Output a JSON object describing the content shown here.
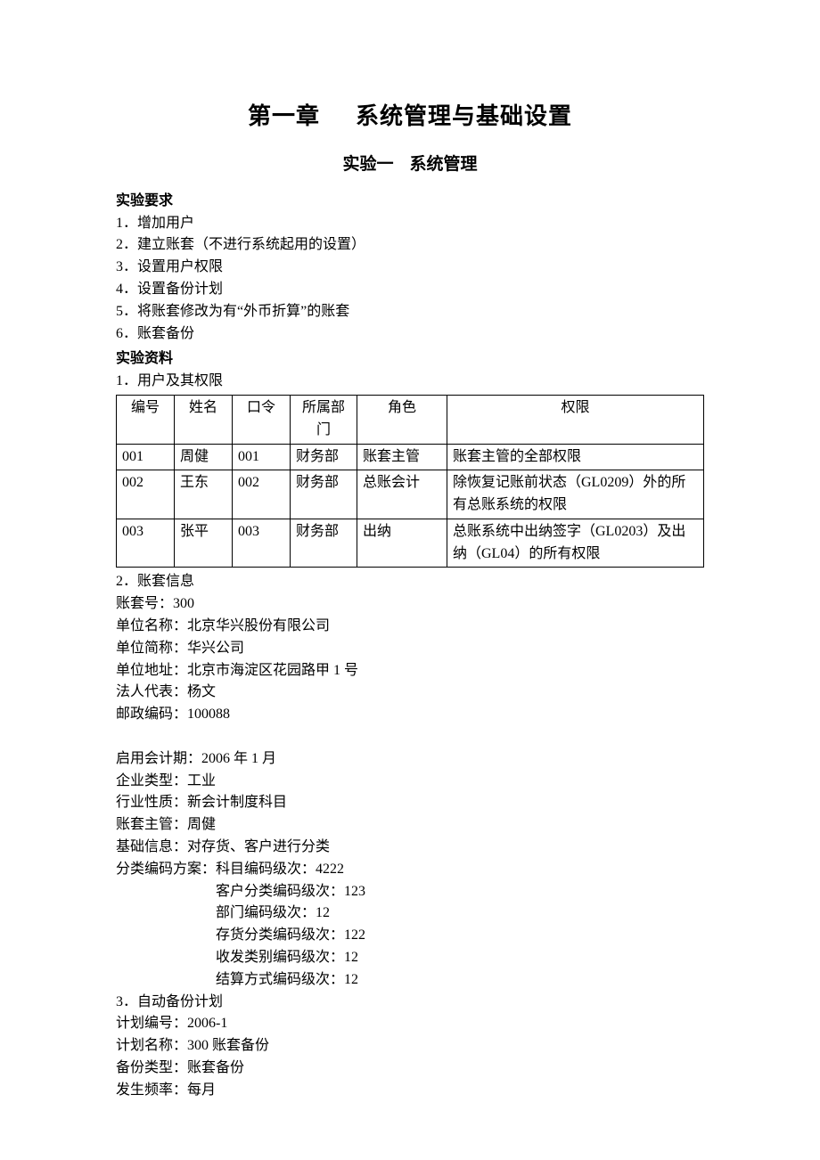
{
  "heading": {
    "chapter_left": "第一章",
    "chapter_right": "系统管理与基础设置",
    "subtitle_left": "实验一",
    "subtitle_right": "系统管理"
  },
  "requirements": {
    "heading": "实验要求",
    "items": [
      "1．增加用户",
      "2．建立账套（不进行系统起用的设置）",
      "3．设置用户权限",
      "4．设置备份计划",
      "5．将账套修改为有“外币折算”的账套",
      "6．账套备份"
    ]
  },
  "materials": {
    "heading": "实验资料",
    "users_heading": "1．用户及其权限",
    "users_table": {
      "headers": [
        "编号",
        "姓名",
        "口令",
        "所属部门",
        "角色",
        "权限"
      ],
      "rows": [
        {
          "id": "001",
          "name": "周健",
          "pwd": "001",
          "dept": "财务部",
          "role": "账套主管",
          "perm": "账套主管的全部权限"
        },
        {
          "id": "002",
          "name": "王东",
          "pwd": "002",
          "dept": "财务部",
          "role": "总账会计",
          "perm": "除恢复记账前状态（GL0209）外的所有总账系统的权限"
        },
        {
          "id": "003",
          "name": "张平",
          "pwd": "003",
          "dept": "财务部",
          "role": "出纳",
          "perm": "总账系统中出纳签字（GL0203）及出纳（GL04）的所有权限"
        }
      ]
    },
    "account_heading": "2．账套信息",
    "account_lines": [
      "账套号：300",
      "单位名称：北京华兴股份有限公司",
      "单位简称：华兴公司",
      "单位地址：北京市海淀区花园路甲 1 号",
      "法人代表：杨文",
      "邮政编码：100088"
    ],
    "account_lines_2": [
      "启用会计期：2006 年 1 月",
      "企业类型：工业",
      "行业性质：新会计制度科目",
      "账套主管：周健",
      "基础信息：对存货、客户进行分类",
      "分类编码方案：科目编码级次：4222"
    ],
    "encoding_lines": [
      "客户分类编码级次：123",
      "部门编码级次：12",
      "存货分类编码级次：122",
      "收发类别编码级次：12",
      "结算方式编码级次：12"
    ],
    "backup_heading": "3．自动备份计划",
    "backup_lines": [
      "计划编号：2006-1",
      "计划名称：300 账套备份",
      "备份类型：账套备份",
      "发生频率：每月"
    ]
  }
}
